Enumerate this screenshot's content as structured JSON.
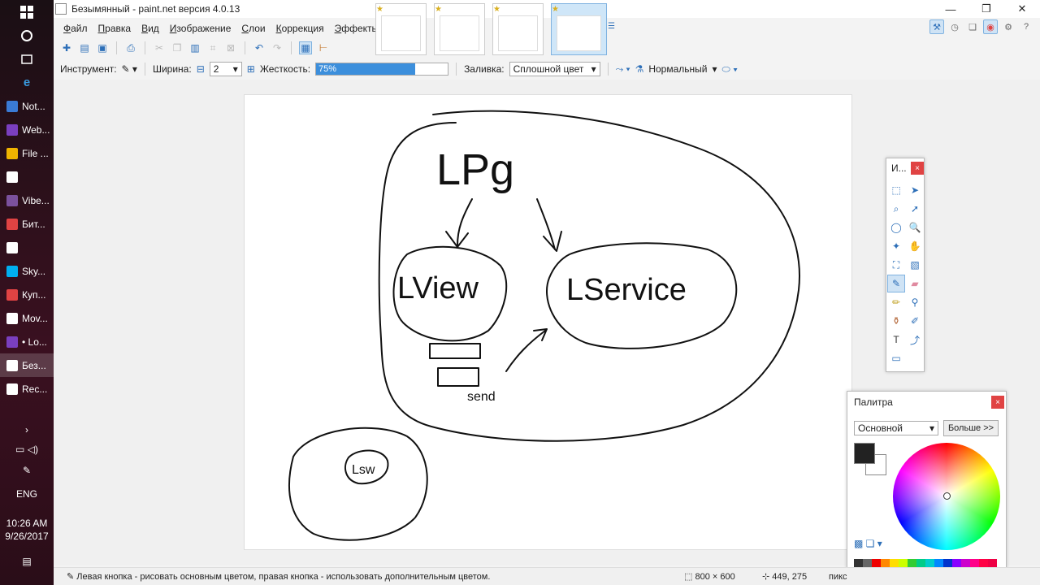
{
  "taskbar": {
    "items": [
      {
        "label": "Not...",
        "color": "#3a7bd5"
      },
      {
        "label": "Web...",
        "color": "#7a3fbf"
      },
      {
        "label": "File ...",
        "color": "#f0b400"
      },
      {
        "label": "",
        "color": "#ffffff"
      },
      {
        "label": "Vibe...",
        "color": "#7b519d"
      },
      {
        "label": "Бит...",
        "color": "#e04343"
      },
      {
        "label": "",
        "color": "#ffffff"
      },
      {
        "label": "Sky...",
        "color": "#00aff0"
      },
      {
        "label": "Куп...",
        "color": "#e04343"
      },
      {
        "label": "Mov...",
        "color": "#ffffff"
      },
      {
        "label": "• Lo...",
        "color": "#7a3fbf"
      },
      {
        "label": "Без...",
        "color": "#ffffff"
      },
      {
        "label": "Rec...",
        "color": "#ffffff"
      }
    ],
    "lang": "ENG",
    "time": "10:26 AM",
    "date": "9/26/2017"
  },
  "window": {
    "title": "Безымянный - paint.net версия 4.0.13",
    "minimize": "—",
    "maximize": "❐",
    "close": "✕"
  },
  "menu": [
    "Файл",
    "Правка",
    "Вид",
    "Изображение",
    "Слои",
    "Коррекция",
    "Эффекты"
  ],
  "toolbar": {
    "tool_label": "Инструмент:",
    "width_label": "Ширина:",
    "width_value": "2",
    "hardness_label": "Жесткость:",
    "hardness_value": "75%",
    "hardness_fraction": 0.75,
    "fill_label": "Заливка:",
    "fill_value": "Сплошной цвет",
    "blend_value": "Нормальный"
  },
  "tools_window": {
    "title": "И..."
  },
  "palette_window": {
    "title": "Палитра",
    "mode": "Основной",
    "more_button": "Больше >>",
    "primary_color": "#222222",
    "secondary_color": "#ffffff"
  },
  "canvas": {
    "text_lpg": "LPg",
    "text_view": "LView",
    "text_service": "LService",
    "text_send": "send",
    "text_lsv": "Lsw"
  },
  "status": {
    "hint": "Левая кнопка - рисовать основным цветом, правая кнопка - использовать дополнительным цветом.",
    "size": "800 × 600",
    "position": "449, 275",
    "unit": "пикс"
  }
}
